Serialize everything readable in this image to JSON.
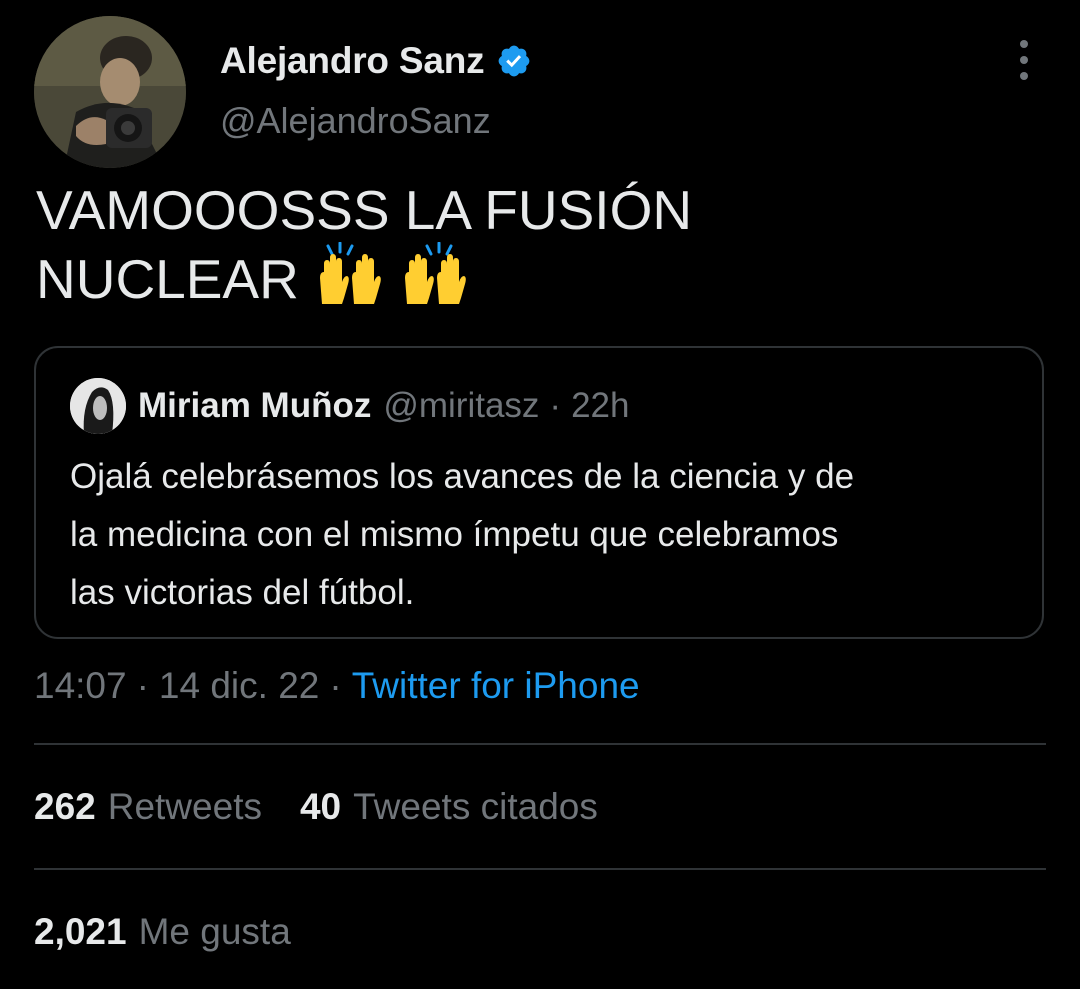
{
  "author": {
    "name": "Alejandro Sanz",
    "handle": "@AlejandroSanz",
    "verified": true
  },
  "tweet": {
    "text_lines": [
      "VAMOOOSSS LA FUSIÓN",
      "NUCLEAR"
    ],
    "emoji": [
      "raising-hands-emoji",
      "raising-hands-emoji"
    ]
  },
  "quoted_tweet": {
    "name": "Miriam Muñoz",
    "handle": "@miritasz",
    "separator": "·",
    "time": "22h",
    "text_lines": [
      "Ojalá celebrásemos los avances de la ciencia y de",
      "la medicina con el mismo ímpetu que celebramos",
      "las victorias del fútbol."
    ]
  },
  "meta": {
    "time": "14:07",
    "separator": "·",
    "date": "14 dic. 22",
    "source": "Twitter for iPhone"
  },
  "stats": {
    "retweets_count": "262",
    "retweets_label": "Retweets",
    "quotes_count": "40",
    "quotes_label": "Tweets citados",
    "likes_count": "2,021",
    "likes_label": "Me gusta"
  },
  "colors": {
    "background": "#000000",
    "text_primary": "#e7e9ea",
    "text_secondary": "#71767b",
    "accent": "#1d9bf0",
    "border": "#2f3336"
  },
  "icons": [
    "verified-badge-icon",
    "more-options-icon"
  ]
}
